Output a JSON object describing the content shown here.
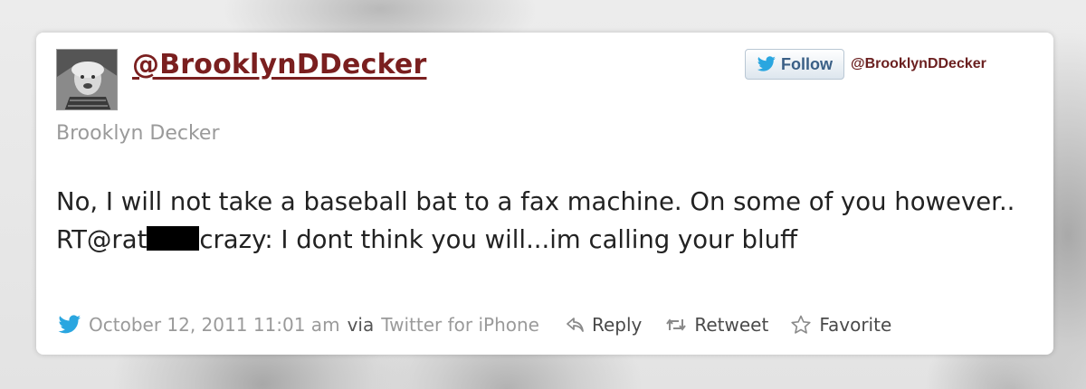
{
  "tweet": {
    "handle": "@BrooklynDDecker",
    "display_name": "Brooklyn Decker",
    "text_part1": "No, I will not take a baseball bat to a fax machine. On some of you however.. RT@rat",
    "text_part2": "crazy: I dont think you will...im calling your bluff"
  },
  "follow": {
    "label": "Follow",
    "handle": "@BrooklynDDecker"
  },
  "meta": {
    "timestamp": "October 12, 2011 11:01 am",
    "via": "via",
    "source": "Twitter for iPhone"
  },
  "actions": {
    "reply": "Reply",
    "retweet": "Retweet",
    "favorite": "Favorite"
  },
  "colors": {
    "handle": "#7a1f1f",
    "twitter_blue": "#2aa6e0",
    "muted": "#9a9a9a"
  },
  "icons": [
    "twitter-bird-icon",
    "reply-icon",
    "retweet-icon",
    "star-icon"
  ]
}
